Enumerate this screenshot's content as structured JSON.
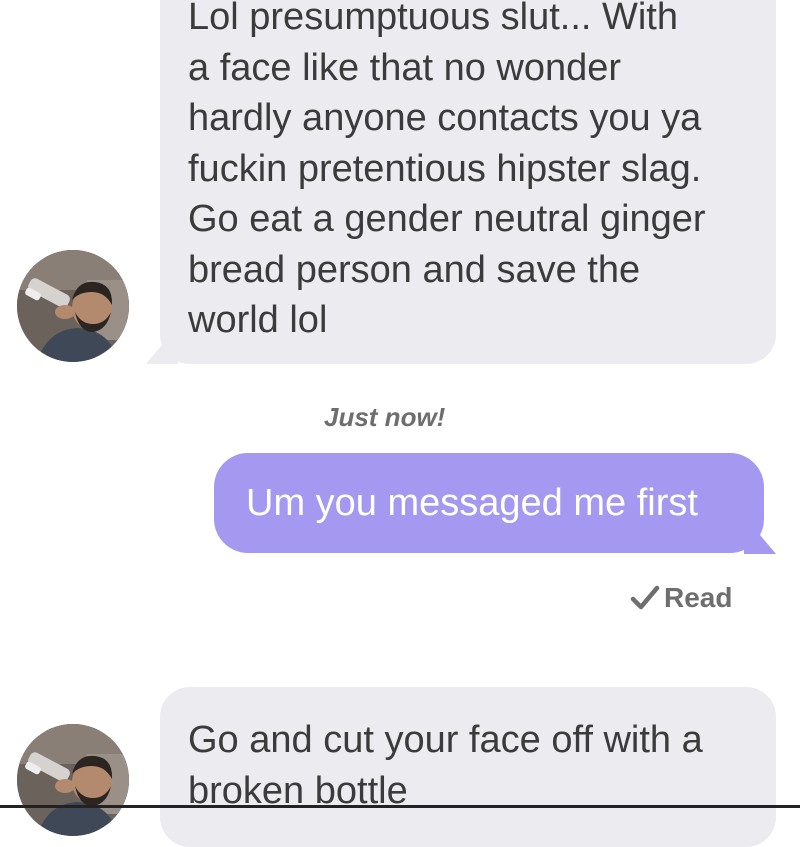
{
  "conversation": {
    "messages": [
      {
        "direction": "incoming",
        "lines": [
          "Lol presumptuous slut... With",
          "a face like that no wonder",
          "hardly anyone contacts you ya",
          "fuckin pretentious hipster slag.",
          "Go eat a gender neutral ginger",
          "bread person and save the",
          "world lol"
        ]
      },
      {
        "direction": "outgoing",
        "timestamp": "Just now!",
        "text": "Um you messaged me first",
        "status": "Read"
      },
      {
        "direction": "incoming",
        "lines": [
          "Go and cut your face off with a",
          "broken bottle"
        ]
      }
    ]
  },
  "colors": {
    "incoming_bubble": "#ebebf0",
    "outgoing_bubble": "#a598f1",
    "meta_text": "#6e6e6e"
  },
  "icons": {
    "avatar": "user-photo-avatar",
    "read": "checkmark-icon"
  }
}
